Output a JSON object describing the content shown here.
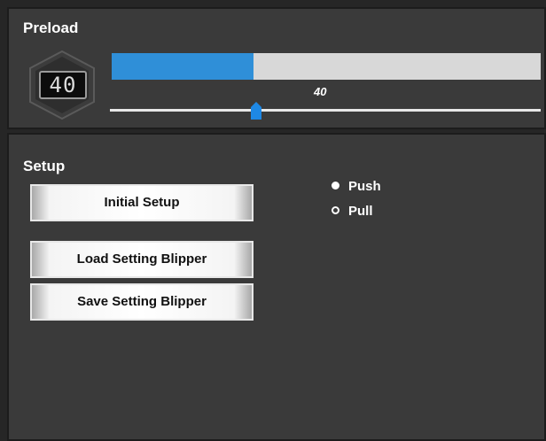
{
  "preload": {
    "title": "Preload",
    "display_value": "40",
    "bar_value_label": "40",
    "level_percent": 33,
    "slider_value_percent": 34,
    "colors": {
      "fill": "#2f8fd8",
      "track": "#d8d8d8",
      "thumb": "#1e88e5"
    }
  },
  "setup": {
    "title": "Setup",
    "buttons": {
      "initial": "Initial Setup",
      "load": "Load Setting Blipper",
      "save": "Save Setting Blipper"
    },
    "radios": {
      "push": "Push",
      "pull": "Pull",
      "selected": "Push"
    }
  }
}
